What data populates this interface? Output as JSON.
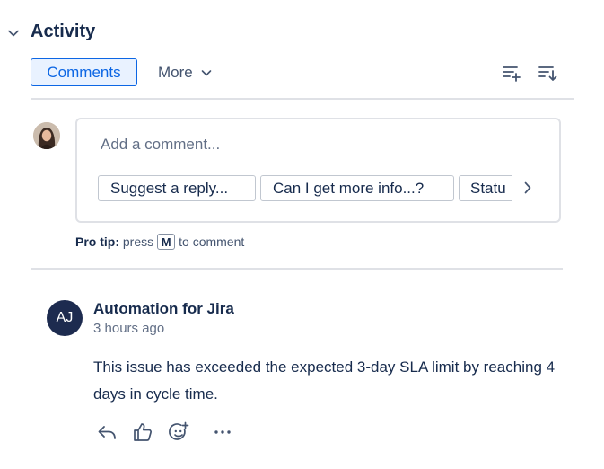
{
  "activity": {
    "title": "Activity",
    "collapse_icon": "chevron-down-icon"
  },
  "tabs": {
    "comments_label": "Comments",
    "more_label": "More",
    "more_icon": "chevron-down-icon"
  },
  "toolbar": {
    "icons": [
      "add-filter-icon",
      "sort-icon"
    ]
  },
  "composer": {
    "placeholder": "Add a comment...",
    "suggestions": [
      "Suggest a reply...",
      "Can I get more info...?",
      "Statu"
    ],
    "next_icon": "chevron-right-icon",
    "pro_tip_label": "Pro tip:",
    "pro_tip_press": "press",
    "pro_tip_key": "M",
    "pro_tip_suffix": "to comment"
  },
  "comment": {
    "avatar_initials": "AJ",
    "author": "Automation for Jira",
    "timestamp": "3 hours ago",
    "body": "This issue has exceeded the expected 3-day SLA limit by reaching 4 days in cycle time.",
    "actions": [
      "reply-icon",
      "like-icon",
      "add-reaction-icon",
      "more-icon"
    ]
  },
  "colors": {
    "accent": "#0c66e4",
    "accent_bg": "#e9f2ff",
    "avatar_bg": "#1d2b4f",
    "text": "#172b4d",
    "subtle": "#626f86",
    "border": "#dfe1e6"
  }
}
